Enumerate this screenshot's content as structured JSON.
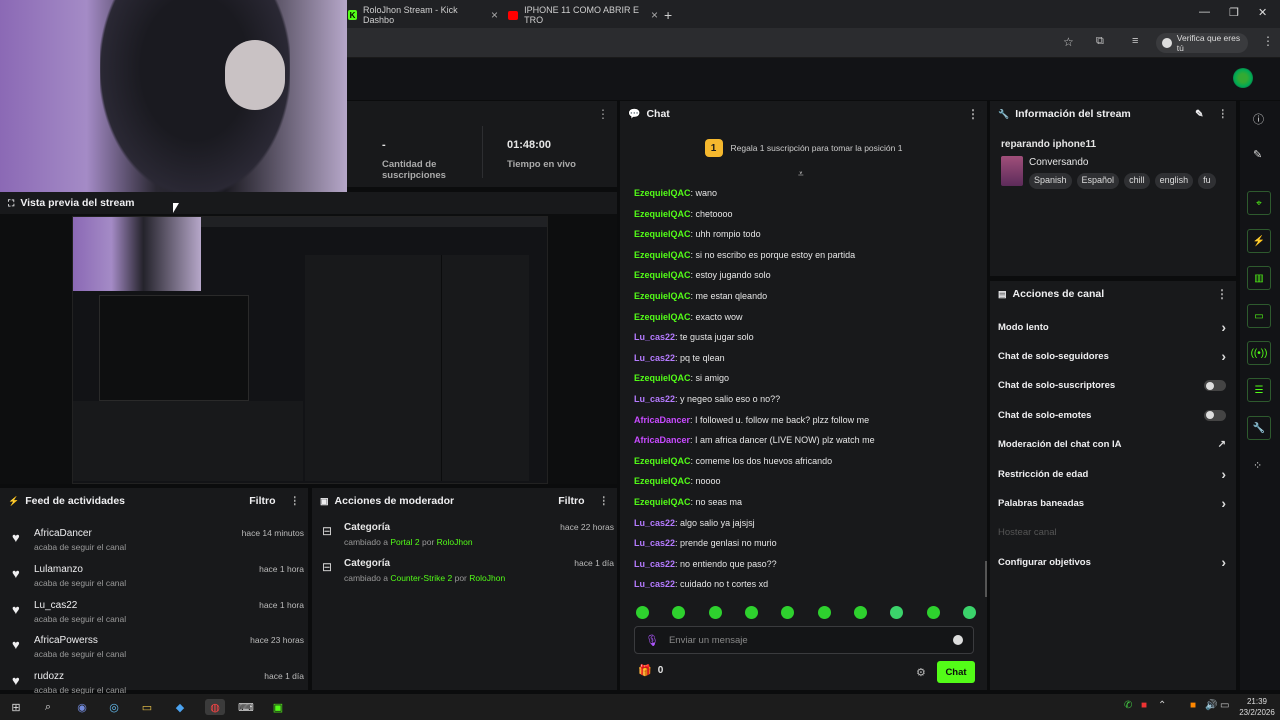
{
  "browser": {
    "tabs": [
      {
        "label": "RoloJhon Stream - Kick Dashbo",
        "icon": "kick-favicon"
      },
      {
        "label": "IPHONE 11 COMO ABRIR E TRO",
        "icon": "youtube-favicon"
      }
    ],
    "profile_label": "Verifica que eres tú"
  },
  "stats": {
    "subs_value": "-",
    "subs_label": "Cantidad de suscripciones",
    "live_value": "01:48:00",
    "live_label": "Tiempo en vivo"
  },
  "preview": {
    "title": "Vista previa del stream"
  },
  "chat": {
    "title": "Chat",
    "gift_rank": "1",
    "gift_text": "Regala 1 suscripción para tomar la posición 1",
    "messages": [
      {
        "user": "EzequielQAC",
        "color": "#53fc18",
        "text": "wano"
      },
      {
        "user": "EzequielQAC",
        "color": "#53fc18",
        "text": "chetoooo"
      },
      {
        "user": "EzequielQAC",
        "color": "#53fc18",
        "text": "uhh rompio todo"
      },
      {
        "user": "EzequielQAC",
        "color": "#53fc18",
        "text": "si no escribo es porque estoy en partida"
      },
      {
        "user": "EzequielQAC",
        "color": "#53fc18",
        "text": "estoy jugando solo"
      },
      {
        "user": "EzequielQAC",
        "color": "#53fc18",
        "text": "me estan qleando"
      },
      {
        "user": "EzequielQAC",
        "color": "#53fc18",
        "text": "exacto wow"
      },
      {
        "user": "Lu_cas22",
        "color": "#b57bff",
        "text": "te gusta jugar solo"
      },
      {
        "user": "Lu_cas22",
        "color": "#b57bff",
        "text": "pq te qlean"
      },
      {
        "user": "EzequielQAC",
        "color": "#53fc18",
        "text": "si amigo"
      },
      {
        "user": "Lu_cas22",
        "color": "#b57bff",
        "text": "y negeo salio eso o no??"
      },
      {
        "user": "AfricaDancer",
        "color": "#c84bff",
        "text": "I followed u. follow me back? plzz follow me"
      },
      {
        "user": "AfricaDancer",
        "color": "#c84bff",
        "text": "I am africa dancer (LIVE NOW) plz watch me"
      },
      {
        "user": "EzequielQAC",
        "color": "#53fc18",
        "text": "comeme los dos huevos africando"
      },
      {
        "user": "EzequielQAC",
        "color": "#53fc18",
        "text": "noooo"
      },
      {
        "user": "EzequielQAC",
        "color": "#53fc18",
        "text": "no seas ma"
      },
      {
        "user": "Lu_cas22",
        "color": "#b57bff",
        "text": "algo salio ya jajsjsj"
      },
      {
        "user": "Lu_cas22",
        "color": "#b57bff",
        "text": "prende genlasi no murio"
      },
      {
        "user": "Lu_cas22",
        "color": "#b57bff",
        "text": "no entiendo que paso??"
      },
      {
        "user": "Lu_cas22",
        "color": "#b57bff",
        "text": "cuidado no t cortes xd"
      }
    ],
    "input_placeholder": "Enviar un mensaje",
    "points": "0",
    "send_label": "Chat"
  },
  "info": {
    "title": "Información del stream",
    "stream_title": "reparando iphone11",
    "category": "Conversando",
    "tags": [
      "Spanish",
      "Español",
      "chill",
      "english",
      "fu"
    ]
  },
  "actions": {
    "title": "Acciones de canal",
    "items": [
      {
        "label": "Modo lento",
        "kind": "chevron"
      },
      {
        "label": "Chat de solo-seguidores",
        "kind": "chevron"
      },
      {
        "label": "Chat de solo-suscriptores",
        "kind": "toggle"
      },
      {
        "label": "Chat de solo-emotes",
        "kind": "toggle"
      },
      {
        "label": "Moderación del chat con IA",
        "kind": "external"
      },
      {
        "label": "Restricción de edad",
        "kind": "chevron"
      },
      {
        "label": "Palabras baneadas",
        "kind": "chevron"
      },
      {
        "label": "Hostear canal",
        "kind": "disabled"
      },
      {
        "label": "Configurar objetivos",
        "kind": "chevron"
      }
    ]
  },
  "feed": {
    "title": "Feed de actividades",
    "filter": "Filtro",
    "items": [
      {
        "name": "AfricaDancer",
        "sub": "acaba de seguir el canal",
        "time": "hace 14 minutos"
      },
      {
        "name": "Lulamanzo",
        "sub": "acaba de seguir el canal",
        "time": "hace 1 hora"
      },
      {
        "name": "Lu_cas22",
        "sub": "acaba de seguir el canal",
        "time": "hace 1 hora"
      },
      {
        "name": "AfricaPowerss",
        "sub": "acaba de seguir el canal",
        "time": "hace 23 horas"
      },
      {
        "name": "rudozz",
        "sub": "acaba de seguir el canal",
        "time": "hace 1 día"
      }
    ]
  },
  "mod": {
    "title": "Acciones de moderador",
    "filter": "Filtro",
    "items": [
      {
        "title": "Categoría",
        "pre": "cambiado a",
        "value": "Portal 2",
        "by": "por",
        "user": "RoloJhon",
        "time": "hace 22 horas"
      },
      {
        "title": "Categoría",
        "pre": "cambiado a",
        "value": "Counter-Strike 2",
        "by": "por",
        "user": "RoloJhon",
        "time": "hace 1 día"
      }
    ]
  },
  "clock": {
    "time": "21:39",
    "date": "23/2/2026"
  },
  "colors": {
    "accent": "#53fc18",
    "panel": "#18191b",
    "bg": "#0b0c0d"
  }
}
